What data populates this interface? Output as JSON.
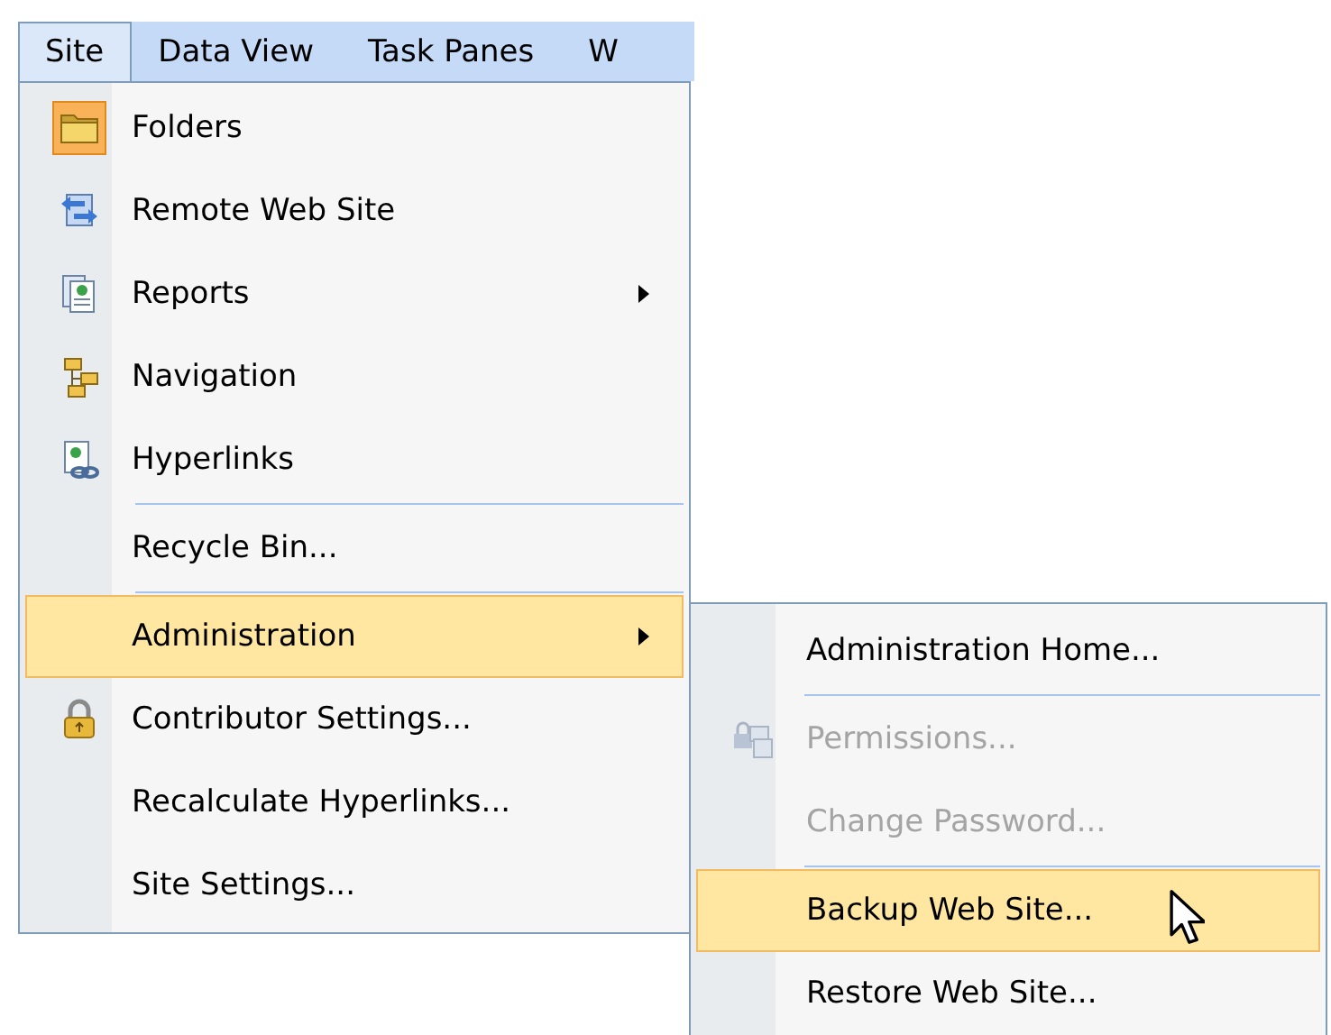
{
  "menu_bar": [
    {
      "label": "Site",
      "selected": true
    },
    {
      "label": "Data View",
      "selected": false
    },
    {
      "label": "Task Panes",
      "selected": false
    },
    {
      "label": "W",
      "selected": false
    }
  ],
  "site_menu": [
    {
      "kind": "item",
      "label": "Folders",
      "checked": true,
      "selected": false,
      "disabled": false,
      "submenu": false
    },
    {
      "kind": "item",
      "label": "Remote Web Site",
      "checked": false,
      "selected": false,
      "disabled": false,
      "submenu": false
    },
    {
      "kind": "item",
      "label": "Reports",
      "checked": false,
      "selected": false,
      "disabled": false,
      "submenu": true
    },
    {
      "kind": "item",
      "label": "Navigation",
      "checked": false,
      "selected": false,
      "disabled": false,
      "submenu": false
    },
    {
      "kind": "item",
      "label": "Hyperlinks",
      "checked": false,
      "selected": false,
      "disabled": false,
      "submenu": false
    },
    {
      "kind": "separator"
    },
    {
      "kind": "item",
      "label": "Recycle Bin...",
      "checked": false,
      "selected": false,
      "disabled": false,
      "submenu": false
    },
    {
      "kind": "separator"
    },
    {
      "kind": "item",
      "label": "Administration",
      "checked": false,
      "selected": true,
      "disabled": false,
      "submenu": true
    },
    {
      "kind": "item",
      "label": "Contributor Settings...",
      "checked": false,
      "selected": false,
      "disabled": false,
      "submenu": false
    },
    {
      "kind": "item",
      "label": "Recalculate Hyperlinks...",
      "checked": false,
      "selected": false,
      "disabled": false,
      "submenu": false
    },
    {
      "kind": "item",
      "label": "Site Settings...",
      "checked": false,
      "selected": false,
      "disabled": false,
      "submenu": false
    }
  ],
  "administration_submenu": [
    {
      "kind": "item",
      "label": "Administration Home...",
      "selected": false,
      "disabled": false
    },
    {
      "kind": "separator"
    },
    {
      "kind": "item",
      "label": "Permissions...",
      "selected": false,
      "disabled": true
    },
    {
      "kind": "item",
      "label": "Change Password...",
      "selected": false,
      "disabled": true
    },
    {
      "kind": "separator"
    },
    {
      "kind": "item",
      "label": "Backup Web Site...",
      "selected": true,
      "disabled": false
    },
    {
      "kind": "item",
      "label": "Restore Web Site...",
      "selected": false,
      "disabled": false
    }
  ]
}
